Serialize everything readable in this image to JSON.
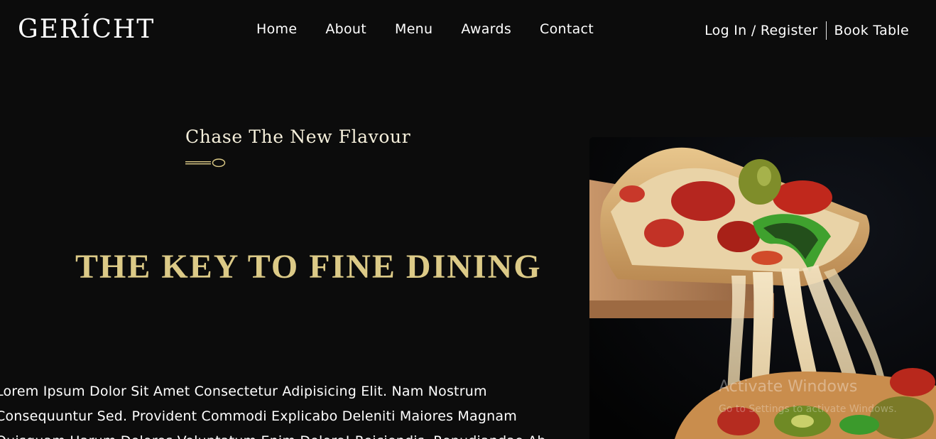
{
  "header": {
    "logo": "GERÍCHT",
    "nav": [
      "Home",
      "About",
      "Menu",
      "Awards",
      "Contact"
    ],
    "login_label": "Log In / Register",
    "book_label": "Book Table"
  },
  "hero": {
    "subtitle": "Chase The New Flavour",
    "headline": "THE KEY TO FINE DINING",
    "body": "Lorem Ipsum Dolor Sit Amet Consectetur Adipisicing Elit. Nam Nostrum Consequuntur Sed. Provident Commodi Explicabo Deleniti Maiores Magnam Quisquam Harum Dolores Voluptatum Enim Dolore! Reiciendis, Repudiandae Ab.",
    "image_alt": "pizza-slice-image"
  },
  "overlay": {
    "title": "Activate Windows",
    "subtitle": "Go to Settings to activate Windows."
  },
  "colors": {
    "background": "#0c0c0c",
    "gold": "#dcca87",
    "text": "#ffffff"
  }
}
